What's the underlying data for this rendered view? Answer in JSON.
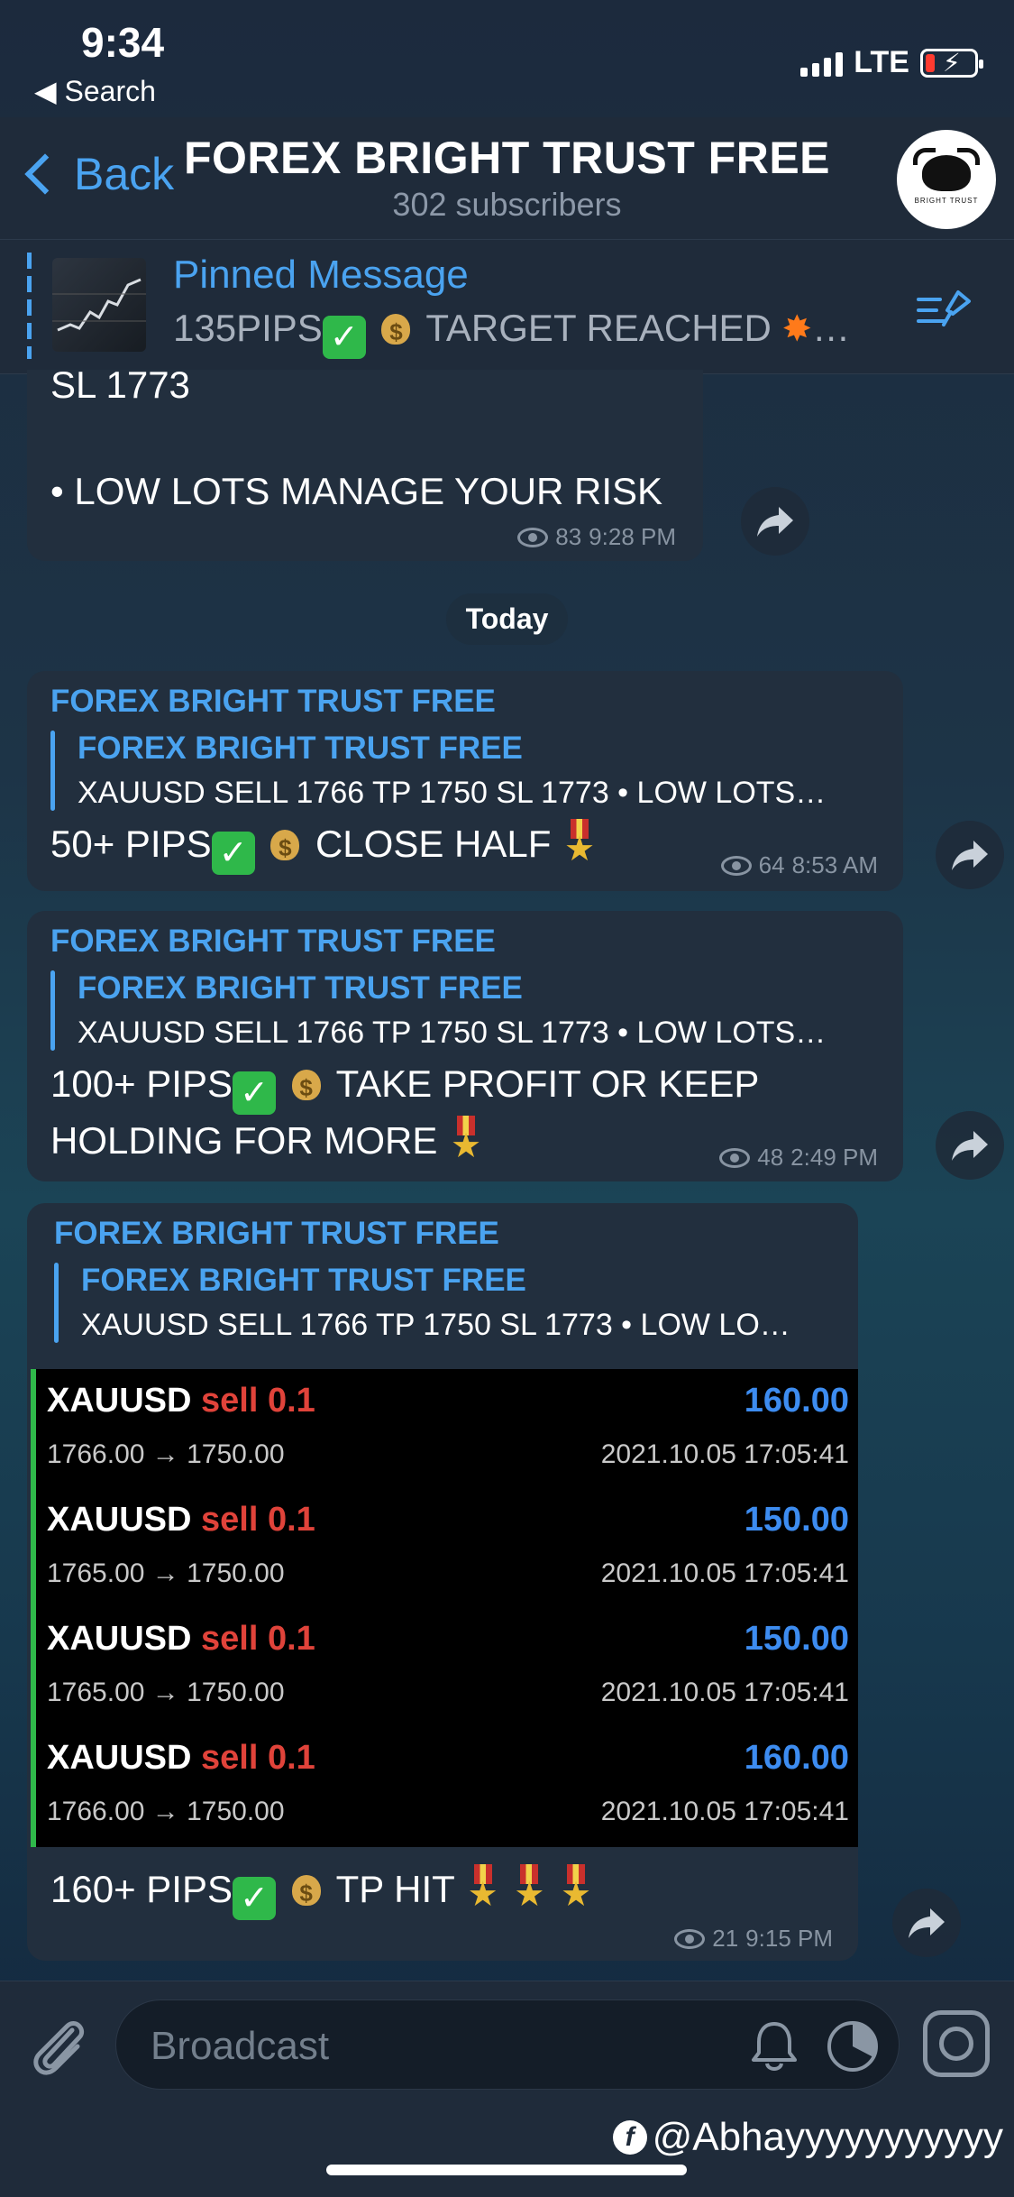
{
  "status": {
    "time": "9:34",
    "back_app": "◀ Search",
    "network": "LTE"
  },
  "nav": {
    "back_label": "Back",
    "title": "FOREX BRIGHT TRUST FREE",
    "subtitle": "302 subscribers",
    "avatar_text": "BRIGHT TRUST"
  },
  "pinned": {
    "title": "Pinned Message",
    "text_a": "135PIPS",
    "text_b": " TARGET REACHED ",
    "ellipsis": "…"
  },
  "prev_message": {
    "line1": "SL 1773",
    "line2": "• LOW LOTS MANAGE YOUR RISK",
    "views": "83",
    "time": "9:28 PM"
  },
  "date_divider": "Today",
  "messages": [
    {
      "forward_from": "FOREX BRIGHT TRUST FREE",
      "reply_name": "FOREX BRIGHT TRUST FREE",
      "reply_text": "XAUUSD SELL 1766 TP 1750 SL 1773 • LOW LOTS…",
      "text_a": "50+ PIPS",
      "text_b": " CLOSE HALF ",
      "views": "64",
      "time": "8:53 AM"
    },
    {
      "forward_from": "FOREX BRIGHT TRUST FREE",
      "reply_name": "FOREX BRIGHT TRUST FREE",
      "reply_text": "XAUUSD SELL 1766 TP 1750 SL 1773 • LOW LOTS…",
      "text_a": "100+ PIPS",
      "text_b": " TAKE PROFIT OR KEEP",
      "text_c": "HOLDING FOR MORE ",
      "views": "48",
      "time": "2:49 PM"
    },
    {
      "forward_from": "FOREX BRIGHT TRUST FREE",
      "reply_name": "FOREX BRIGHT TRUST FREE",
      "reply_text": "XAUUSD SELL 1766 TP 1750 SL 1773 • LOW LO…",
      "text_a": "160+ PIPS",
      "text_b": " TP HIT ",
      "views": "21",
      "time": "9:15 PM"
    }
  ],
  "trades": [
    {
      "symbol": "XAUUSD",
      "side": "sell 0.1",
      "prices": "1766.00 → 1750.00",
      "profit": "160.00",
      "datetime": "2021.10.05 17:05:41"
    },
    {
      "symbol": "XAUUSD",
      "side": "sell 0.1",
      "prices": "1765.00 → 1750.00",
      "profit": "150.00",
      "datetime": "2021.10.05 17:05:41"
    },
    {
      "symbol": "XAUUSD",
      "side": "sell 0.1",
      "prices": "1765.00 → 1750.00",
      "profit": "150.00",
      "datetime": "2021.10.05 17:05:41"
    },
    {
      "symbol": "XAUUSD",
      "side": "sell 0.1",
      "prices": "1766.00 → 1750.00",
      "profit": "160.00",
      "datetime": "2021.10.05 17:05:41"
    }
  ],
  "input": {
    "placeholder": "Broadcast"
  },
  "watermark": "@Abhayyyyyyyyyyy",
  "colors": {
    "accent": "#4aa3f0",
    "sell": "#e0433a",
    "profit": "#3d8cf0",
    "trade_border": "#2fb84a"
  }
}
